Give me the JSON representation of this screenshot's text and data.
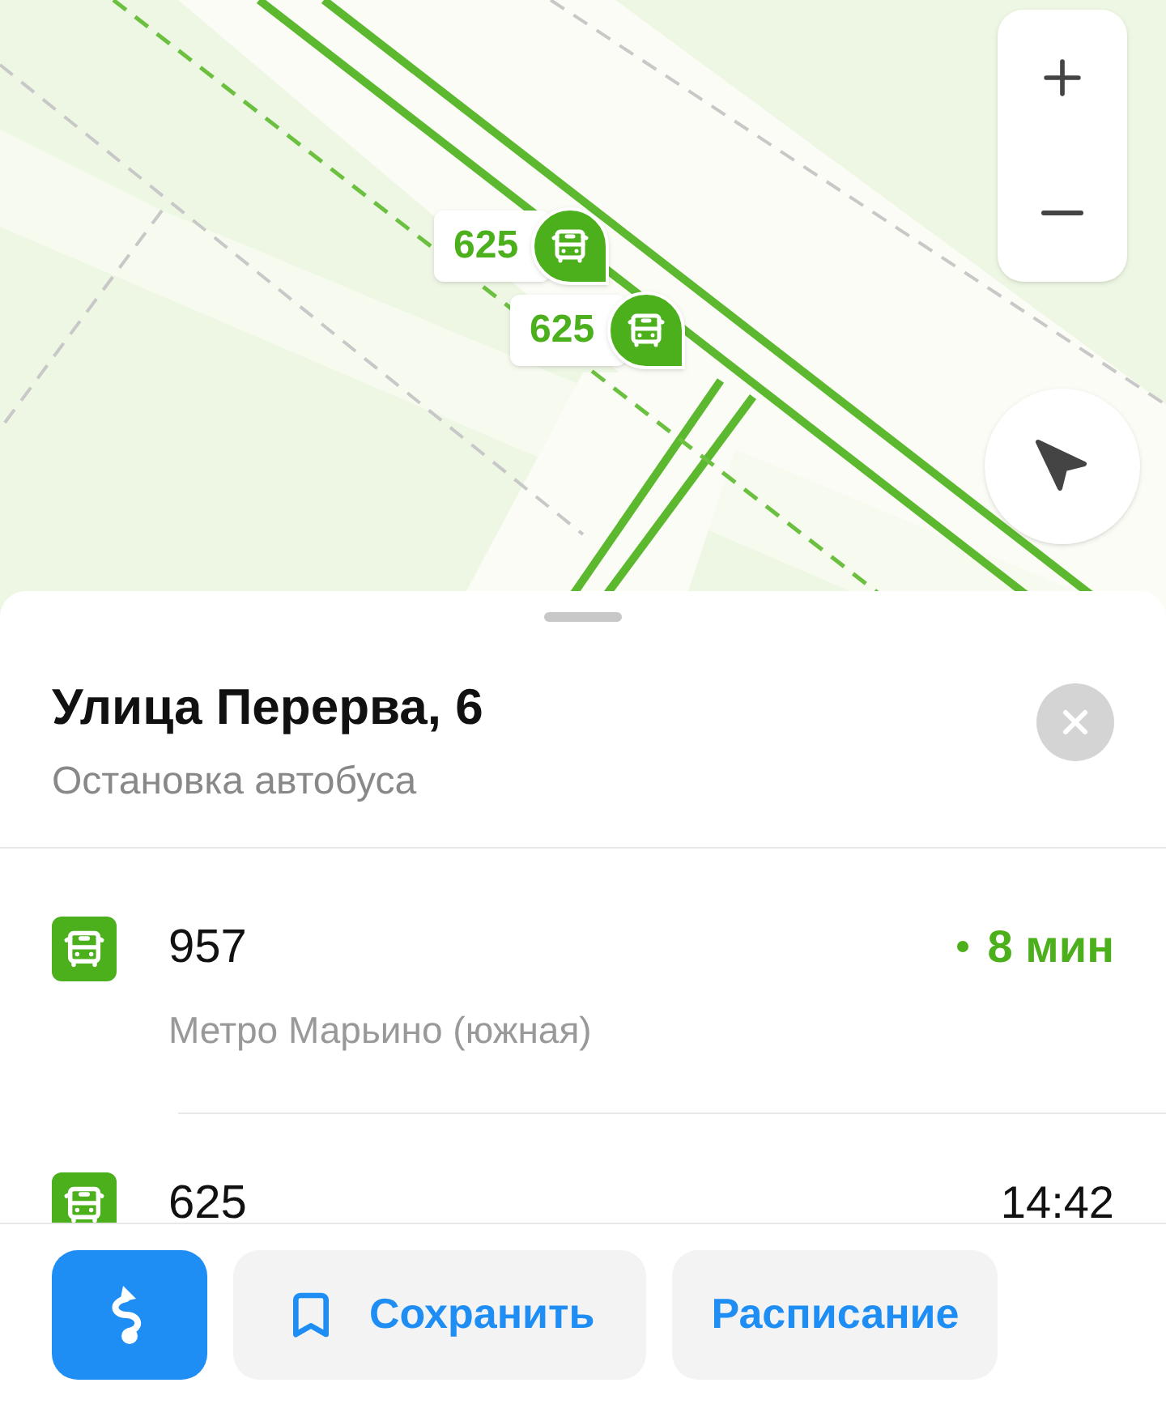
{
  "map": {
    "markers": [
      {
        "route": "625"
      },
      {
        "route": "625"
      }
    ]
  },
  "stop": {
    "title": "Улица Перерва, 6",
    "subtitle": "Остановка автобуса"
  },
  "arrivals": [
    {
      "kind": "live",
      "route": "957",
      "destination": "Метро Марьино (южная)",
      "time": "8 мин"
    },
    {
      "kind": "scheduled",
      "route": "625",
      "time": "14:42"
    }
  ],
  "actions": [
    {
      "kind": "route"
    },
    {
      "kind": "save",
      "label": "Сохранить"
    },
    {
      "kind": "schedule",
      "label": "Расписание"
    }
  ]
}
